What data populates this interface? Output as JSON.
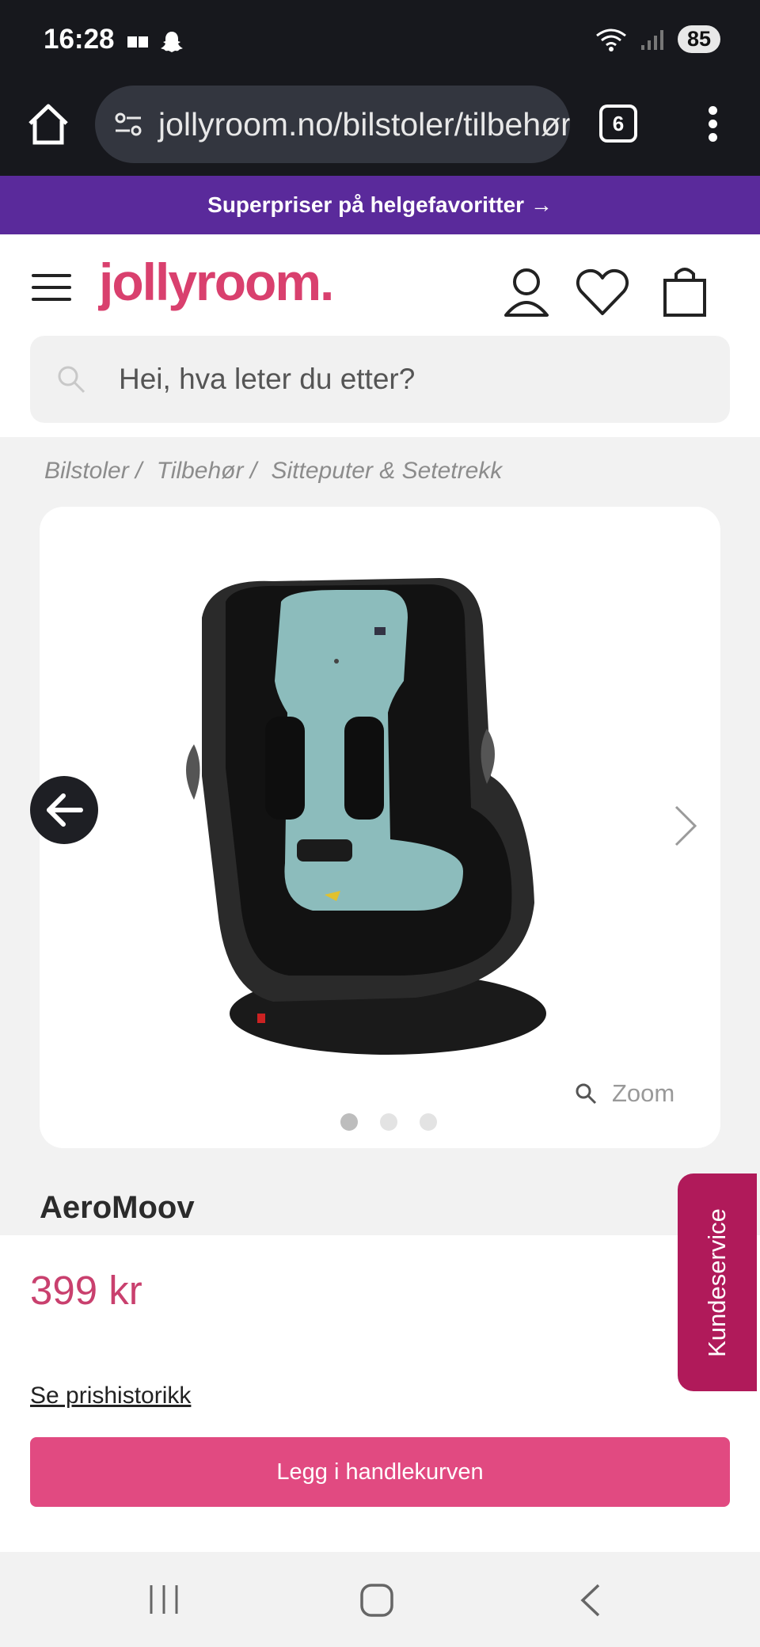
{
  "status": {
    "time": "16:28",
    "battery": "85"
  },
  "browser": {
    "url": "jollyroom.no/bilstoler/tilbehør",
    "tab_count": "6"
  },
  "promo": {
    "text": "Superpriser på helgefavoritter →"
  },
  "header": {
    "logo": "jollyroom."
  },
  "search": {
    "placeholder": "Hei, hva leter du etter?"
  },
  "breadcrumb": [
    "Bilstoler /",
    "Tilbehør /",
    "Sitteputer & Setetrekk"
  ],
  "gallery": {
    "zoom_label": "Zoom",
    "slide_count": 3,
    "active_slide": 1
  },
  "product": {
    "brand": "AeroMoov",
    "price": "399 kr",
    "history_link": "Se prishistorikk",
    "cart_button": "Legg i handlekurven"
  },
  "support": {
    "label": "Kundeservice"
  },
  "colors": {
    "brand_pink": "#d9406e",
    "promo_purple": "#5a2a9b",
    "cart_pink": "#e14a81",
    "support_magenta": "#b01a5a",
    "seat_mint": "#8cbcbc"
  }
}
